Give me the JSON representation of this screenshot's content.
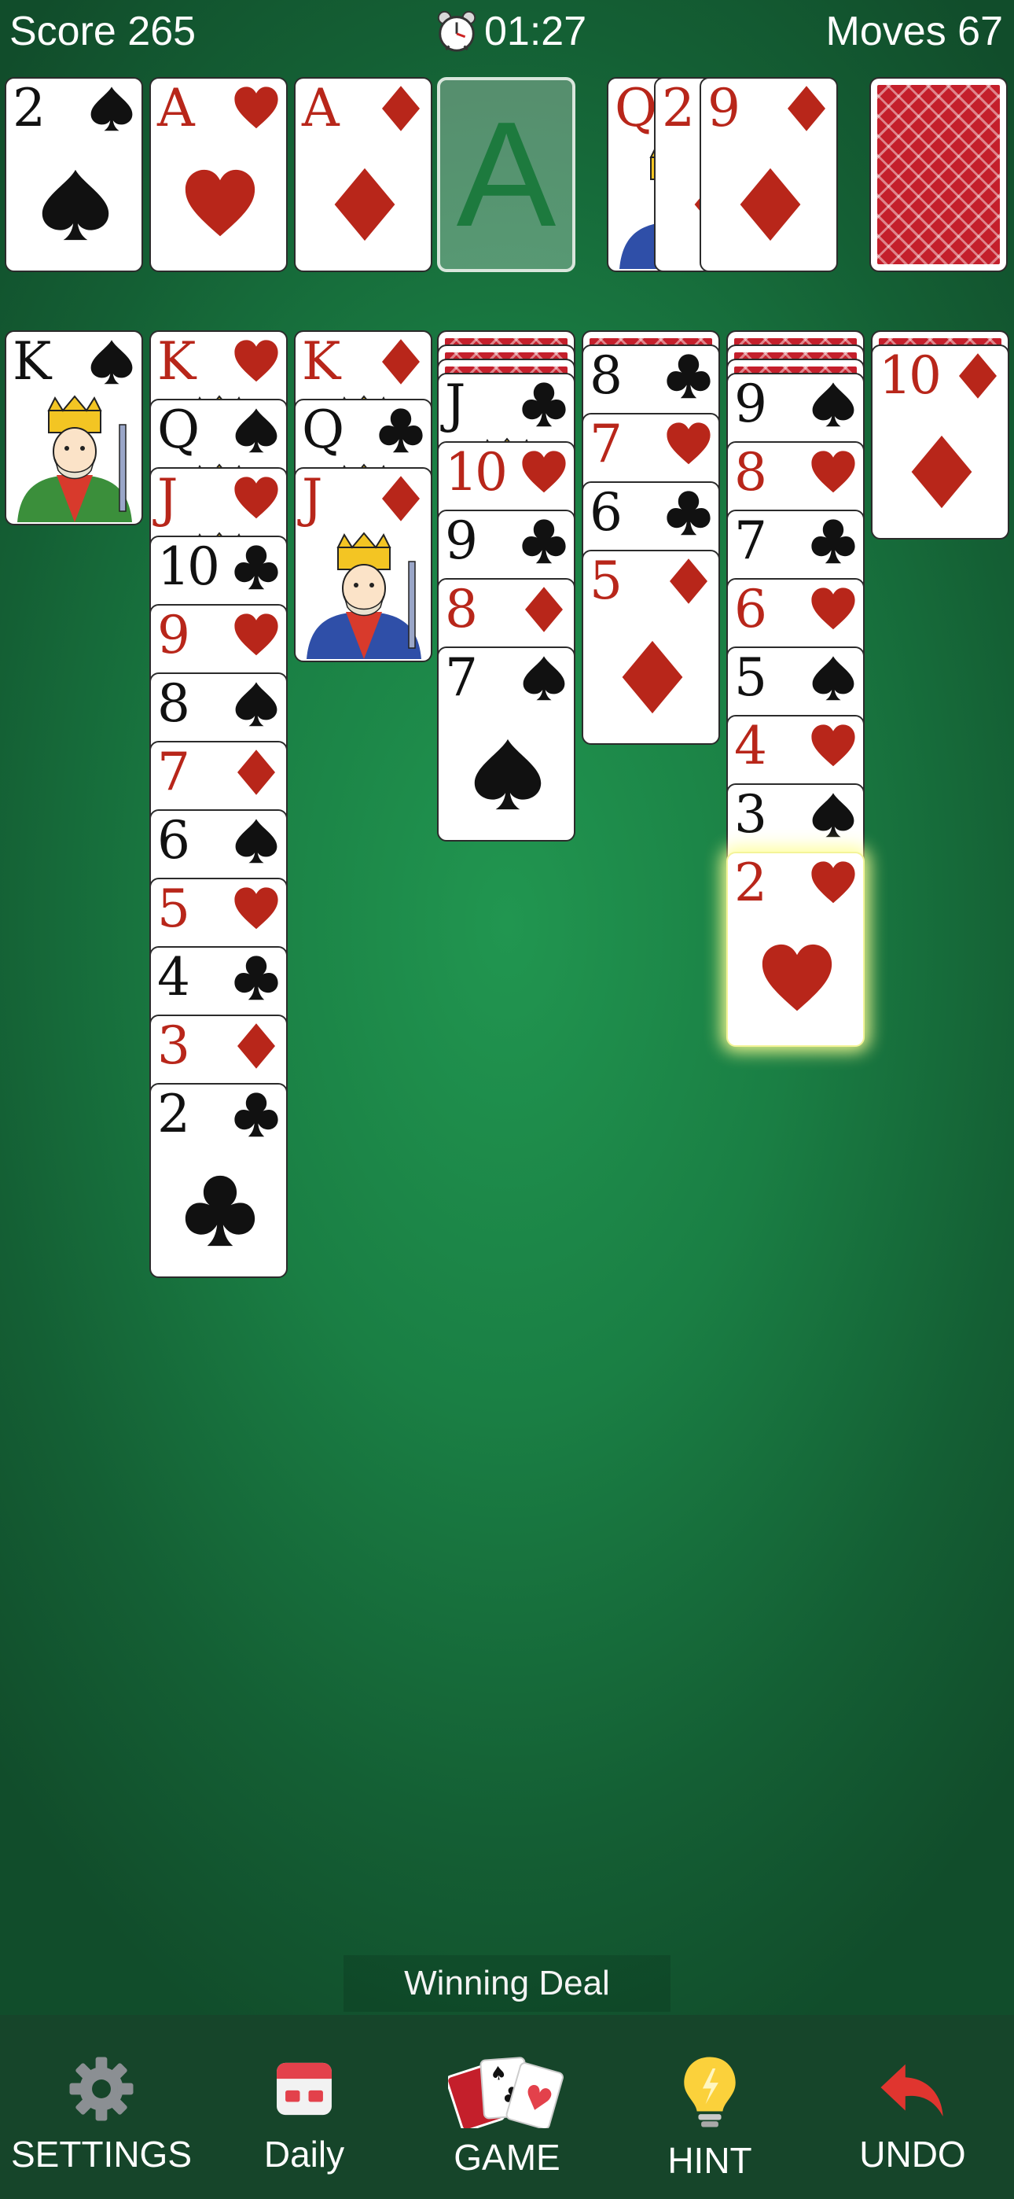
{
  "header": {
    "score_label": "Score 265",
    "timer": "01:27",
    "moves_label": "Moves 67"
  },
  "foundations": [
    {
      "rank": "2",
      "suit": "spades",
      "color": "black"
    },
    {
      "rank": "A",
      "suit": "hearts",
      "color": "red"
    },
    {
      "rank": "A",
      "suit": "diamonds",
      "color": "red"
    },
    {
      "empty": true,
      "placeholder": "A"
    }
  ],
  "waste": [
    {
      "rank": "Q",
      "suit": "diamonds",
      "color": "red"
    },
    {
      "rank": "2",
      "suit": "diamonds",
      "color": "red"
    },
    {
      "rank": "9",
      "suit": "diamonds",
      "color": "red"
    }
  ],
  "stock": {
    "face_down": true
  },
  "tableau": [
    {
      "face_down": 0,
      "cards": [
        {
          "rank": "K",
          "suit": "spades",
          "color": "black"
        }
      ]
    },
    {
      "face_down": 0,
      "cards": [
        {
          "rank": "K",
          "suit": "hearts",
          "color": "red"
        },
        {
          "rank": "Q",
          "suit": "spades",
          "color": "black"
        },
        {
          "rank": "J",
          "suit": "hearts",
          "color": "red"
        },
        {
          "rank": "10",
          "suit": "clubs",
          "color": "black"
        },
        {
          "rank": "9",
          "suit": "hearts",
          "color": "red"
        },
        {
          "rank": "8",
          "suit": "spades",
          "color": "black"
        },
        {
          "rank": "7",
          "suit": "diamonds",
          "color": "red"
        },
        {
          "rank": "6",
          "suit": "spades",
          "color": "black"
        },
        {
          "rank": "5",
          "suit": "hearts",
          "color": "red"
        },
        {
          "rank": "4",
          "suit": "clubs",
          "color": "black"
        },
        {
          "rank": "3",
          "suit": "diamonds",
          "color": "red"
        },
        {
          "rank": "2",
          "suit": "clubs",
          "color": "black"
        }
      ]
    },
    {
      "face_down": 0,
      "cards": [
        {
          "rank": "K",
          "suit": "diamonds",
          "color": "red"
        },
        {
          "rank": "Q",
          "suit": "clubs",
          "color": "black"
        },
        {
          "rank": "J",
          "suit": "diamonds",
          "color": "red"
        }
      ]
    },
    {
      "face_down": 3,
      "cards": [
        {
          "rank": "J",
          "suit": "clubs",
          "color": "black"
        },
        {
          "rank": "10",
          "suit": "hearts",
          "color": "red"
        },
        {
          "rank": "9",
          "suit": "clubs",
          "color": "black"
        },
        {
          "rank": "8",
          "suit": "diamonds",
          "color": "red"
        },
        {
          "rank": "7",
          "suit": "spades",
          "color": "black"
        }
      ]
    },
    {
      "face_down": 1,
      "cards": [
        {
          "rank": "8",
          "suit": "clubs",
          "color": "black"
        },
        {
          "rank": "7",
          "suit": "hearts",
          "color": "red"
        },
        {
          "rank": "6",
          "suit": "clubs",
          "color": "black"
        },
        {
          "rank": "5",
          "suit": "diamonds",
          "color": "red"
        }
      ]
    },
    {
      "face_down": 3,
      "cards": [
        {
          "rank": "9",
          "suit": "spades",
          "color": "black"
        },
        {
          "rank": "8",
          "suit": "hearts",
          "color": "red"
        },
        {
          "rank": "7",
          "suit": "clubs",
          "color": "black"
        },
        {
          "rank": "6",
          "suit": "hearts",
          "color": "red"
        },
        {
          "rank": "5",
          "suit": "spades",
          "color": "black"
        },
        {
          "rank": "4",
          "suit": "hearts",
          "color": "red"
        },
        {
          "rank": "3",
          "suit": "spades",
          "color": "black"
        },
        {
          "rank": "2",
          "suit": "hearts",
          "color": "red",
          "highlighted": true
        }
      ]
    },
    {
      "face_down": 1,
      "cards": [
        {
          "rank": "10",
          "suit": "diamonds",
          "color": "red"
        }
      ]
    }
  ],
  "banner": "Winning Deal",
  "toolbar": {
    "settings": {
      "label": "SETTINGS",
      "icon": "gear-icon"
    },
    "daily": {
      "label": "Daily",
      "icon": "calendar-icon"
    },
    "game": {
      "label": "GAME",
      "icon": "cards-icon"
    },
    "hint": {
      "label": "HINT",
      "icon": "lightbulb-icon"
    },
    "undo": {
      "label": "UNDO",
      "icon": "undo-arrow-icon"
    }
  },
  "colors": {
    "red_suit": "#b8261a",
    "black_suit": "#111111",
    "card_back": "#c41f2b",
    "felt": "#1a7f44",
    "toolbar_bg": "#16452a"
  }
}
